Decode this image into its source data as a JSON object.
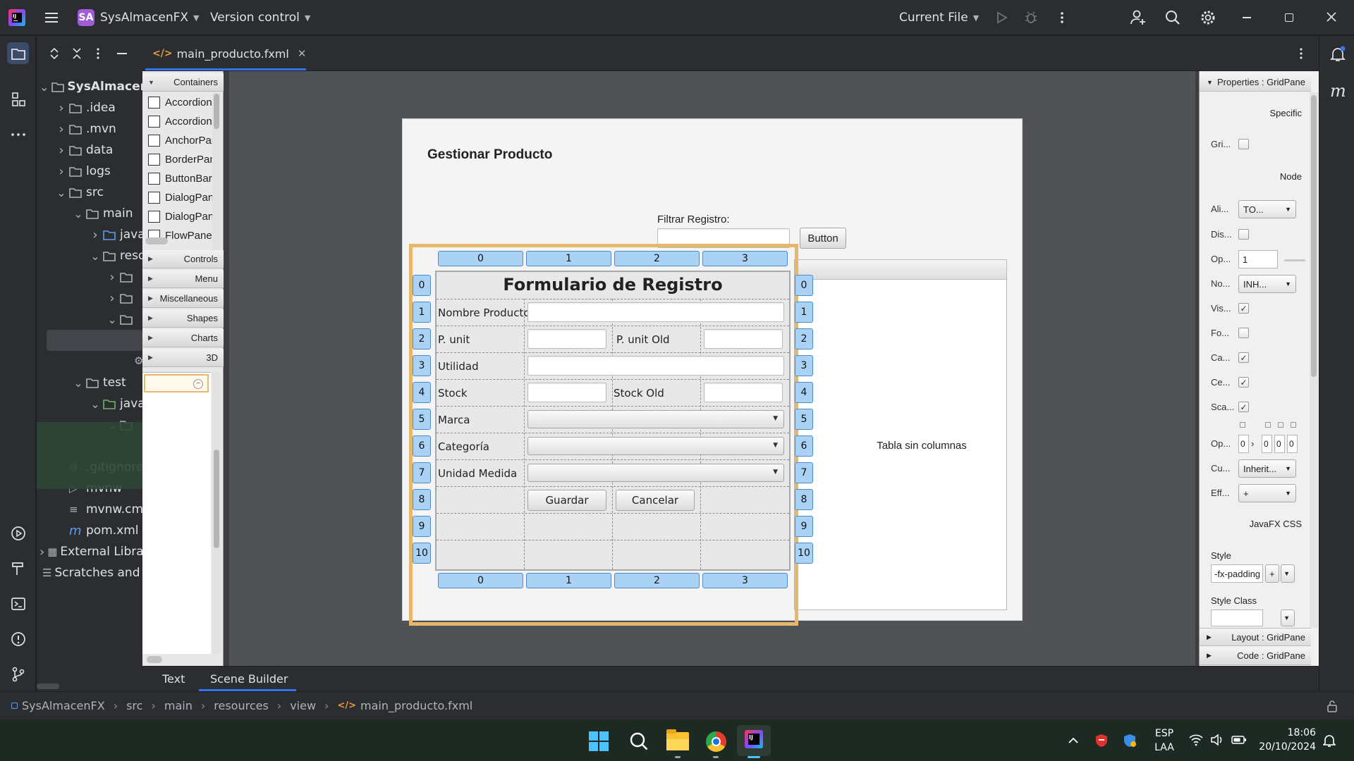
{
  "title_bar": {
    "project_badge": "SA",
    "project_name": "SysAlmacenFX",
    "vcs": "Version control",
    "run_config": "Current File",
    "colors": {
      "badge": "#9f5bd8",
      "accent": "#3574f0"
    }
  },
  "project_tree": {
    "items": [
      {
        "label": "SysAlmacenFX",
        "expanded": true
      },
      {
        "label": ".idea"
      },
      {
        "label": ".mvn"
      },
      {
        "label": "data"
      },
      {
        "label": "logs"
      },
      {
        "label": "src",
        "expanded": true
      },
      {
        "label": "main",
        "expanded": true
      },
      {
        "label": "java"
      },
      {
        "label": "resources",
        "expanded": true
      },
      {
        "label": ""
      },
      {
        "label": ""
      },
      {
        "label": "",
        "expanded": true
      },
      {
        "label": ""
      },
      {
        "label": ""
      },
      {
        "label": "test",
        "expanded": true
      },
      {
        "label": "java",
        "expanded": true
      },
      {
        "label": "",
        "expanded": true
      },
      {
        "label": ".gitignore"
      },
      {
        "label": "mvnw"
      },
      {
        "label": "mvnw.cmd"
      },
      {
        "label": "pom.xml"
      },
      {
        "label": "External Libraries"
      },
      {
        "label": "Scratches and Consoles"
      }
    ]
  },
  "editor_tab": {
    "label": "main_producto.fxml"
  },
  "library": {
    "sections": [
      "Containers",
      "Controls",
      "Menu",
      "Miscellaneous",
      "Shapes",
      "Charts",
      "3D"
    ],
    "containers": [
      "Accordion",
      "Accordion",
      "AnchorPane",
      "BorderPane",
      "ButtonBar",
      "DialogPane",
      "DialogPane",
      "FlowPane"
    ]
  },
  "form": {
    "heading": "Gestionar Producto",
    "filter_label": "Filtrar Registro:",
    "filter_button": "Button",
    "grid_title": "Formulario de Registro",
    "labels": {
      "nombre": "Nombre Producto:",
      "punit": "P. unit",
      "punit_old": "P. unit Old",
      "utilidad": "Utilidad",
      "stock": "Stock",
      "stock_old": "Stock Old",
      "marca": "Marca",
      "categoria": "Categoría",
      "unidad": "Unidad Medida"
    },
    "save_button": "Guardar",
    "cancel_button": "Cancelar",
    "table_placeholder": "Tabla sin columnas",
    "columns": [
      "0",
      "1",
      "2",
      "3"
    ],
    "rows": [
      "0",
      "1",
      "2",
      "3",
      "4",
      "5",
      "6",
      "7",
      "8",
      "9",
      "10"
    ]
  },
  "inspector": {
    "properties_header": "Properties : GridPane",
    "specific": "Specific",
    "node": "Node",
    "rows": [
      {
        "label": "Gri...",
        "kind": "check",
        "checked": false
      },
      {
        "label": "Ali...",
        "kind": "combo",
        "value": "TO..."
      },
      {
        "label": "Dis...",
        "kind": "check",
        "checked": false
      },
      {
        "label": "Op...",
        "kind": "field",
        "value": "1"
      },
      {
        "label": "No...",
        "kind": "combo",
        "value": "INH..."
      },
      {
        "label": "Vis...",
        "kind": "check",
        "checked": true
      },
      {
        "label": "Fo...",
        "kind": "check",
        "checked": false
      },
      {
        "label": "Ca...",
        "kind": "check",
        "checked": true
      },
      {
        "label": "Ce...",
        "kind": "check",
        "checked": true
      },
      {
        "label": "Sca...",
        "kind": "check",
        "checked": true
      },
      {
        "label": "Op...",
        "kind": "orient",
        "values": [
          "0",
          "0",
          "0",
          "0"
        ]
      },
      {
        "label": "Cu...",
        "kind": "combo",
        "value": "Inherit..."
      },
      {
        "label": "Eff...",
        "kind": "combo",
        "value": "+"
      }
    ],
    "javafx_css": "JavaFX CSS",
    "style_label": "Style",
    "style_value": "-fx-padding",
    "style_class_label": "Style Class",
    "layout_header": "Layout : GridPane",
    "code_header": "Code : GridPane"
  },
  "bottom_tabs": {
    "text": "Text",
    "scene_builder": "Scene Builder"
  },
  "breadcrumb": [
    "SysAlmacenFX",
    "src",
    "main",
    "resources",
    "view",
    "main_producto.fxml"
  ],
  "taskbar": {
    "lang": "ESP",
    "layout": "LAA",
    "time": "18:06",
    "date": "20/10/2024"
  }
}
